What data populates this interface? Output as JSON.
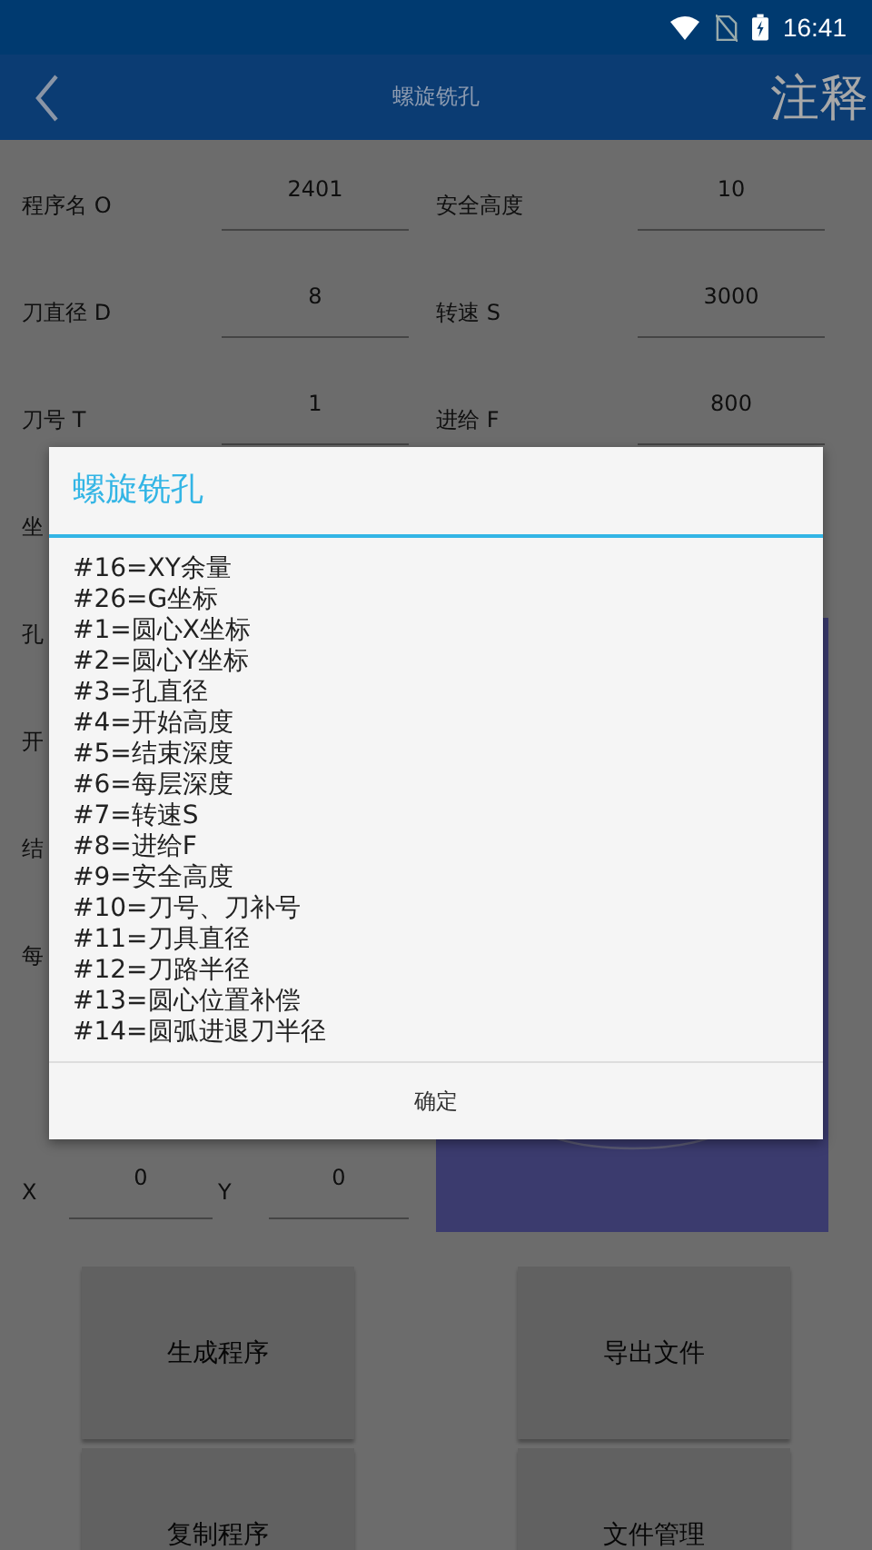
{
  "status_bar": {
    "time": "16:41"
  },
  "app_bar": {
    "title": "螺旋铣孔",
    "action": "注释"
  },
  "form": {
    "left": [
      {
        "label": "程序名 O",
        "value": "2401"
      },
      {
        "label": "刀直径 D",
        "value": "8"
      },
      {
        "label": "刀号 T",
        "value": "1"
      },
      {
        "label": "坐"
      },
      {
        "label": "孔"
      },
      {
        "label": "开"
      },
      {
        "label": "结"
      },
      {
        "label": "每"
      }
    ],
    "right": [
      {
        "label": "安全高度",
        "value": "10"
      },
      {
        "label": "转速 S",
        "value": "3000"
      },
      {
        "label": "进给 F",
        "value": "800"
      }
    ],
    "coords": [
      {
        "label": "X",
        "value": "0"
      },
      {
        "label": "Y",
        "value": "0"
      }
    ]
  },
  "buttons": [
    "生成程序",
    "导出文件",
    "复制程序",
    "文件管理"
  ],
  "dialog": {
    "title": "螺旋铣孔",
    "lines": [
      "#16=XY余量",
      "#26=G坐标",
      "#1=圆心X坐标",
      "#2=圆心Y坐标",
      "#3=孔直径",
      "#4=开始高度",
      "#5=结束深度",
      "#6=每层深度",
      "#7=转速S",
      "#8=进给F",
      "#9=安全高度",
      "#10=刀号、刀补号",
      "#11=刀具直径",
      "#12=刀路半径",
      "#13=圆心位置补偿",
      "#14=圆弧进退刀半径"
    ],
    "button": "确定"
  }
}
